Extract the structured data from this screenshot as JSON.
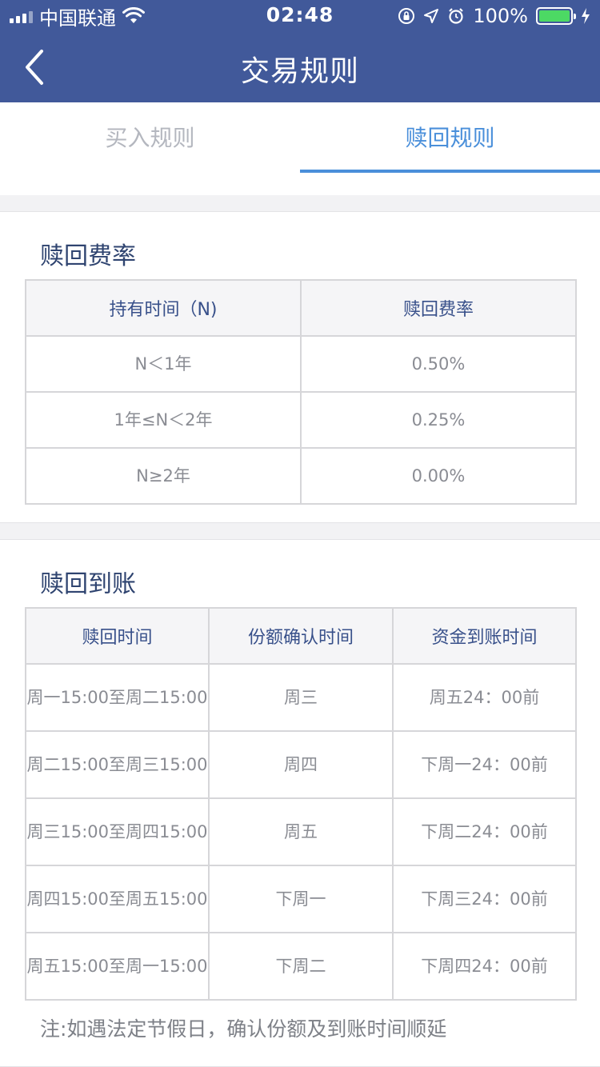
{
  "status_bar": {
    "carrier": "中国联通",
    "time": "02:48",
    "battery_percent": "100%",
    "battery_fill": 1.0,
    "signal_bars": 3
  },
  "nav": {
    "title": "交易规则"
  },
  "tabs": [
    {
      "label": "买入规则",
      "active": false
    },
    {
      "label": "赎回规则",
      "active": true
    }
  ],
  "fee_section": {
    "title": "赎回费率",
    "headers": [
      "持有时间（N)",
      "赎回费率"
    ],
    "rows": [
      [
        "N＜1年",
        "0.50%"
      ],
      [
        "1年≤N＜2年",
        "0.25%"
      ],
      [
        "N≥2年",
        "0.00%"
      ]
    ]
  },
  "arrival_section": {
    "title": "赎回到账",
    "headers": [
      "赎回时间",
      "份额确认时间",
      "资金到账时间"
    ],
    "rows": [
      [
        "周一15:00至周二15:00",
        "周三",
        "周五24：00前"
      ],
      [
        "周二15:00至周三15:00",
        "周四",
        "下周一24：00前"
      ],
      [
        "周三15:00至周四15:00",
        "周五",
        "下周二24：00前"
      ],
      [
        "周四15:00至周五15:00",
        "下周一",
        "下周三24：00前"
      ],
      [
        "周五15:00至周一15:00",
        "下周二",
        "下周四24：00前"
      ]
    ],
    "note": "注:如遇法定节假日，确认份额及到账时间顺延"
  },
  "colors": {
    "brand": "#41599a",
    "tab_active": "#4a8fda",
    "tab_inactive": "#b4b7bf",
    "section_title": "#2f4470",
    "battery_green": "#4cd964"
  }
}
